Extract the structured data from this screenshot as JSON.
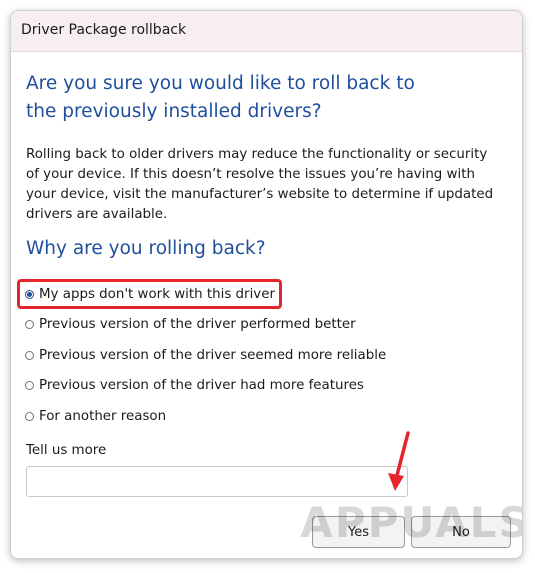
{
  "window": {
    "title": "Driver Package rollback"
  },
  "heading": "Are you sure you would like to roll back to the previously installed drivers?",
  "description": "Rolling back to older drivers may reduce the functionality or security of your device.  If this doesn’t resolve the issues you’re having with your device, visit the manufacturer’s website to determine if updated drivers are available.",
  "reasons": {
    "title": "Why are you rolling back?",
    "options": [
      {
        "label": "My apps don't work with this driver",
        "checked": true
      },
      {
        "label": "Previous version of the driver performed better",
        "checked": false
      },
      {
        "label": "Previous version of the driver seemed more reliable",
        "checked": false
      },
      {
        "label": "Previous version of the driver had more features",
        "checked": false
      },
      {
        "label": "For another reason",
        "checked": false
      }
    ]
  },
  "tell_more": {
    "label": "Tell us more",
    "value": ""
  },
  "buttons": {
    "yes": "Yes",
    "no": "No"
  },
  "watermark": "APPUALS",
  "colors": {
    "accent": "#1f4e9c",
    "highlight": "#e4262c",
    "titlebar": "#f7eef1"
  }
}
